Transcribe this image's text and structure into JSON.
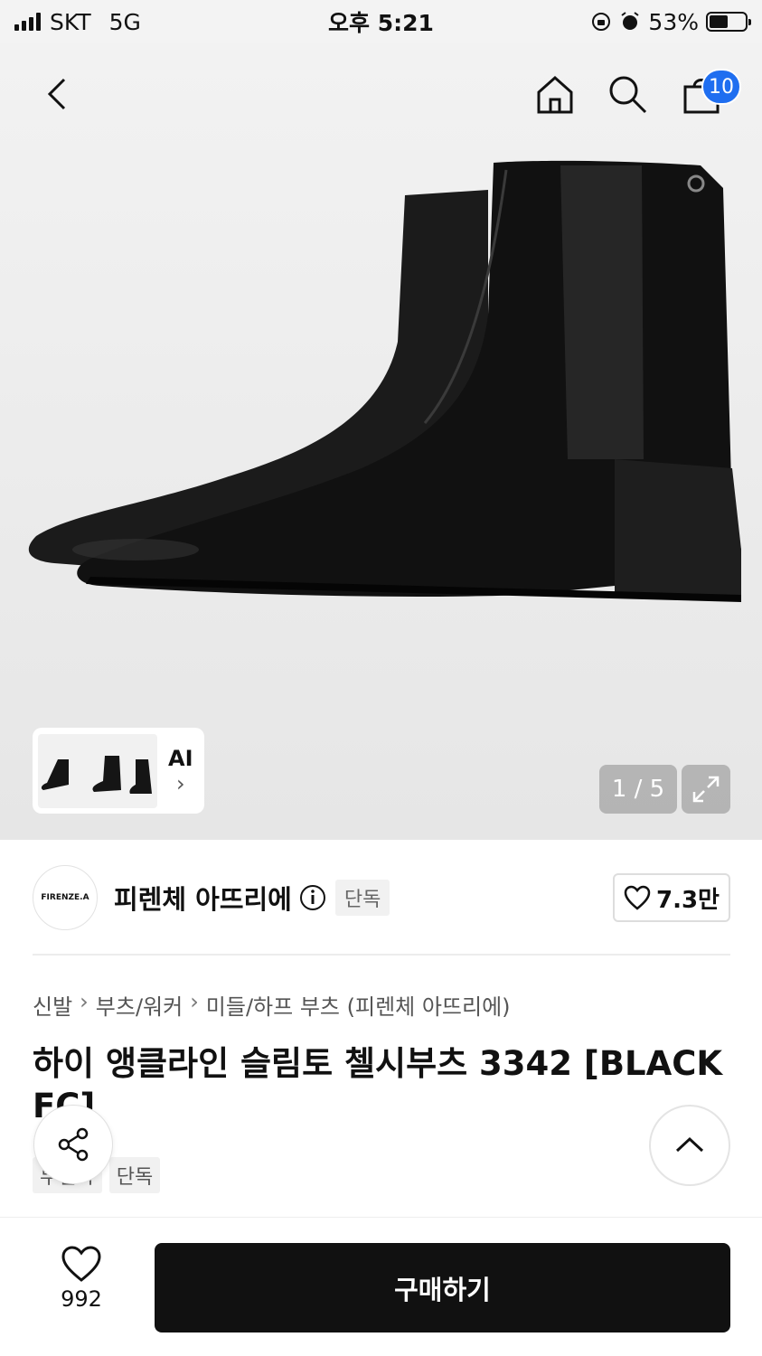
{
  "status": {
    "carrier": "SKT",
    "network": "5G",
    "time": "오후 5:21",
    "battery": "53%",
    "battery_level": 0.53
  },
  "header": {
    "cart_count": "10",
    "icons": [
      "back-icon",
      "home-icon",
      "search-icon",
      "cart-icon"
    ]
  },
  "gallery": {
    "thumb_label": "AI",
    "thumb_chevron": "›",
    "pager": "1 / 5"
  },
  "brand": {
    "logo_text": "FIRENZE.A",
    "name": "피렌체 아뜨리에",
    "exclusive_badge": "단독",
    "likes": "7.3만"
  },
  "breadcrumb": {
    "items": [
      "신발",
      "부츠/워커",
      "미들/하프 부츠 (피렌체 아뜨리에)"
    ],
    "separator": "›"
  },
  "product": {
    "title": "하이 앵클라인 슬림토 첼시부츠 3342 [BLACK FC]",
    "tags": [
      "무신사",
      "단독"
    ]
  },
  "bottom": {
    "wish_count": "992",
    "buy_label": "구매하기"
  },
  "colors": {
    "accent": "#1f6ef0",
    "buy": "#111111"
  }
}
